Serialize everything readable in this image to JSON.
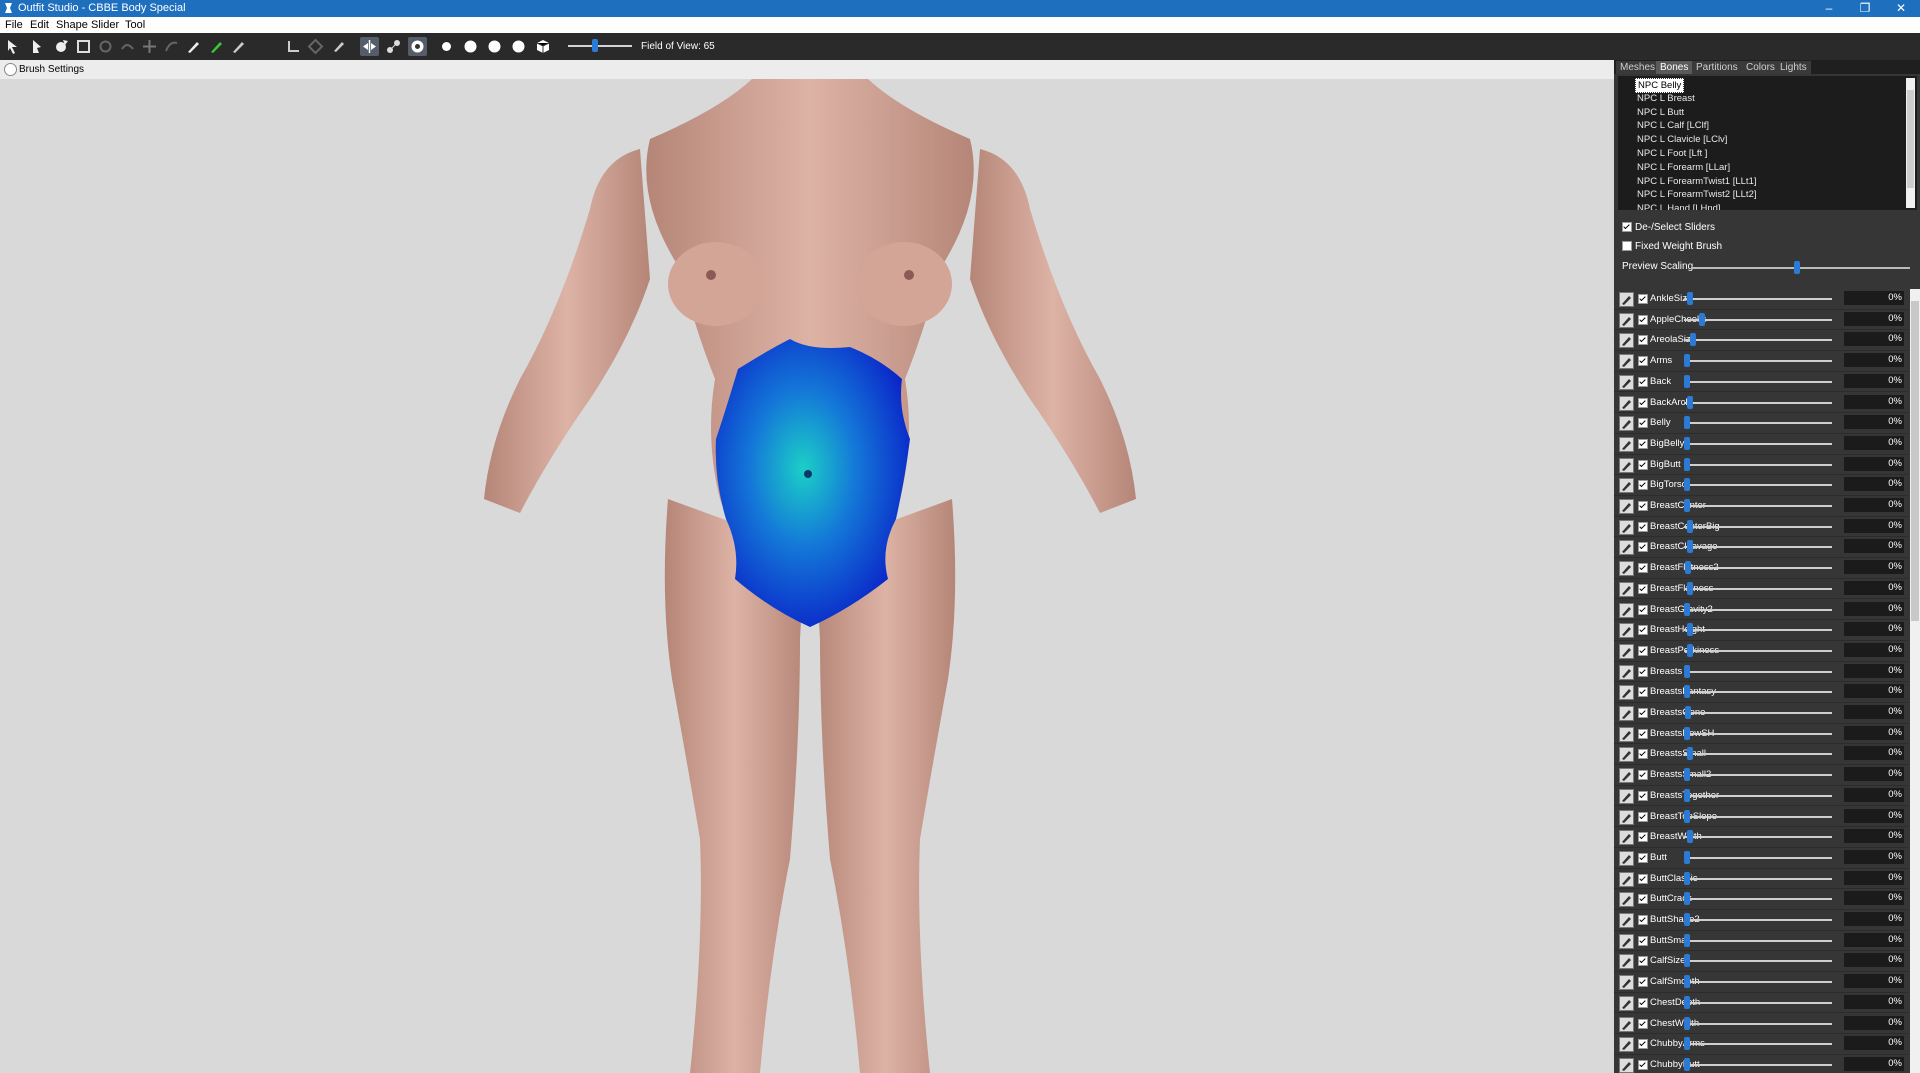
{
  "window": {
    "title": "Outfit Studio - CBBE Body Special",
    "minimize": "–",
    "restore": "❐",
    "close": "✕"
  },
  "menu": [
    "File",
    "Edit",
    "Shape",
    "Slider",
    "Tool"
  ],
  "toolbar": {
    "fov_label": "Field of View: 65",
    "fov_value": 65
  },
  "viewport": {
    "brush_settings": "Brush Settings"
  },
  "panel": {
    "tabs": [
      "Meshes",
      "Bones",
      "Partitions",
      "Colors",
      "Lights"
    ],
    "selected_tab": "Bones",
    "bones": [
      "NPC Belly",
      "NPC L Breast",
      "NPC L Butt",
      "NPC L Calf [LClf]",
      "NPC L Clavicle [LClv]",
      "NPC L Foot [Lft ]",
      "NPC L Forearm [LLar]",
      "NPC L ForearmTwist1 [LLt1]",
      "NPC L ForearmTwist2 [LLt2]",
      "NPC L Hand [LHnd]"
    ],
    "selected_bone": "NPC Belly",
    "deselect_sliders": "De-/Select Sliders",
    "deselect_checked": true,
    "fixed_weight_brush": "Fixed Weight Brush",
    "fixed_weight_checked": false,
    "preview_scaling": "Preview Scaling",
    "preview_scaling_level": 0.47
  },
  "sliders": [
    {
      "name": "AnkleSize",
      "value": "0%",
      "level": 0.02
    },
    {
      "name": "AppleCheeks",
      "value": "0%",
      "level": 0.1
    },
    {
      "name": "AreolaSize",
      "value": "0%",
      "level": 0.04
    },
    {
      "name": "Arms",
      "value": "0%",
      "level": 0.0
    },
    {
      "name": "Back",
      "value": "0%",
      "level": 0.0
    },
    {
      "name": "BackArch",
      "value": "0%",
      "level": 0.02
    },
    {
      "name": "Belly",
      "value": "0%",
      "level": 0.0
    },
    {
      "name": "BigBelly",
      "value": "0%",
      "level": 0.0
    },
    {
      "name": "BigButt",
      "value": "0%",
      "level": 0.0
    },
    {
      "name": "BigTorso",
      "value": "0%",
      "level": 0.0
    },
    {
      "name": "BreastCenter",
      "value": "0%",
      "level": 0.0
    },
    {
      "name": "BreastCenterBig",
      "value": "0%",
      "level": 0.02
    },
    {
      "name": "BreastCleavage",
      "value": "0%",
      "level": 0.02
    },
    {
      "name": "BreastFlatness2",
      "value": "0%",
      "level": 0.01
    },
    {
      "name": "BreastFlatness",
      "value": "0%",
      "level": 0.02
    },
    {
      "name": "BreastGravity2",
      "value": "0%",
      "level": 0.0
    },
    {
      "name": "BreastHeight",
      "value": "0%",
      "level": 0.02
    },
    {
      "name": "BreastPerkiness",
      "value": "0%",
      "level": 0.02
    },
    {
      "name": "Breasts",
      "value": "0%",
      "level": 0.0
    },
    {
      "name": "BreastsFantasy",
      "value": "0%",
      "level": 0.0
    },
    {
      "name": "BreastsGone",
      "value": "0%",
      "level": 0.01
    },
    {
      "name": "BreastsNewSH",
      "value": "0%",
      "level": 0.0
    },
    {
      "name": "BreastsSmall",
      "value": "0%",
      "level": 0.02
    },
    {
      "name": "BreastsSmall2",
      "value": "0%",
      "level": 0.0
    },
    {
      "name": "BreastsTogether",
      "value": "0%",
      "level": 0.0
    },
    {
      "name": "BreastTopSlope",
      "value": "0%",
      "level": 0.0
    },
    {
      "name": "BreastWidth",
      "value": "0%",
      "level": 0.02
    },
    {
      "name": "Butt",
      "value": "0%",
      "level": 0.0
    },
    {
      "name": "ButtClassic",
      "value": "0%",
      "level": 0.0
    },
    {
      "name": "ButtCrack",
      "value": "0%",
      "level": 0.0
    },
    {
      "name": "ButtShape2",
      "value": "0%",
      "level": 0.0
    },
    {
      "name": "ButtSmall",
      "value": "0%",
      "level": 0.0
    },
    {
      "name": "CalfSize",
      "value": "0%",
      "level": 0.0
    },
    {
      "name": "CalfSmooth",
      "value": "0%",
      "level": 0.0
    },
    {
      "name": "ChestDepth",
      "value": "0%",
      "level": 0.0
    },
    {
      "name": "ChestWidth",
      "value": "0%",
      "level": 0.0
    },
    {
      "name": "ChubbyArms",
      "value": "0%",
      "level": 0.0
    },
    {
      "name": "ChubbyButt",
      "value": "0%",
      "level": 0.0
    }
  ],
  "colors": {
    "title_bar": "#1f6fbf",
    "toolbar": "#2a2a2a",
    "panel": "#363636",
    "accent": "#2b7bd6",
    "weight_paint": "#0a2fd0",
    "weight_paint_center": "#1fc3c8",
    "skin": "#d9aa9c"
  }
}
